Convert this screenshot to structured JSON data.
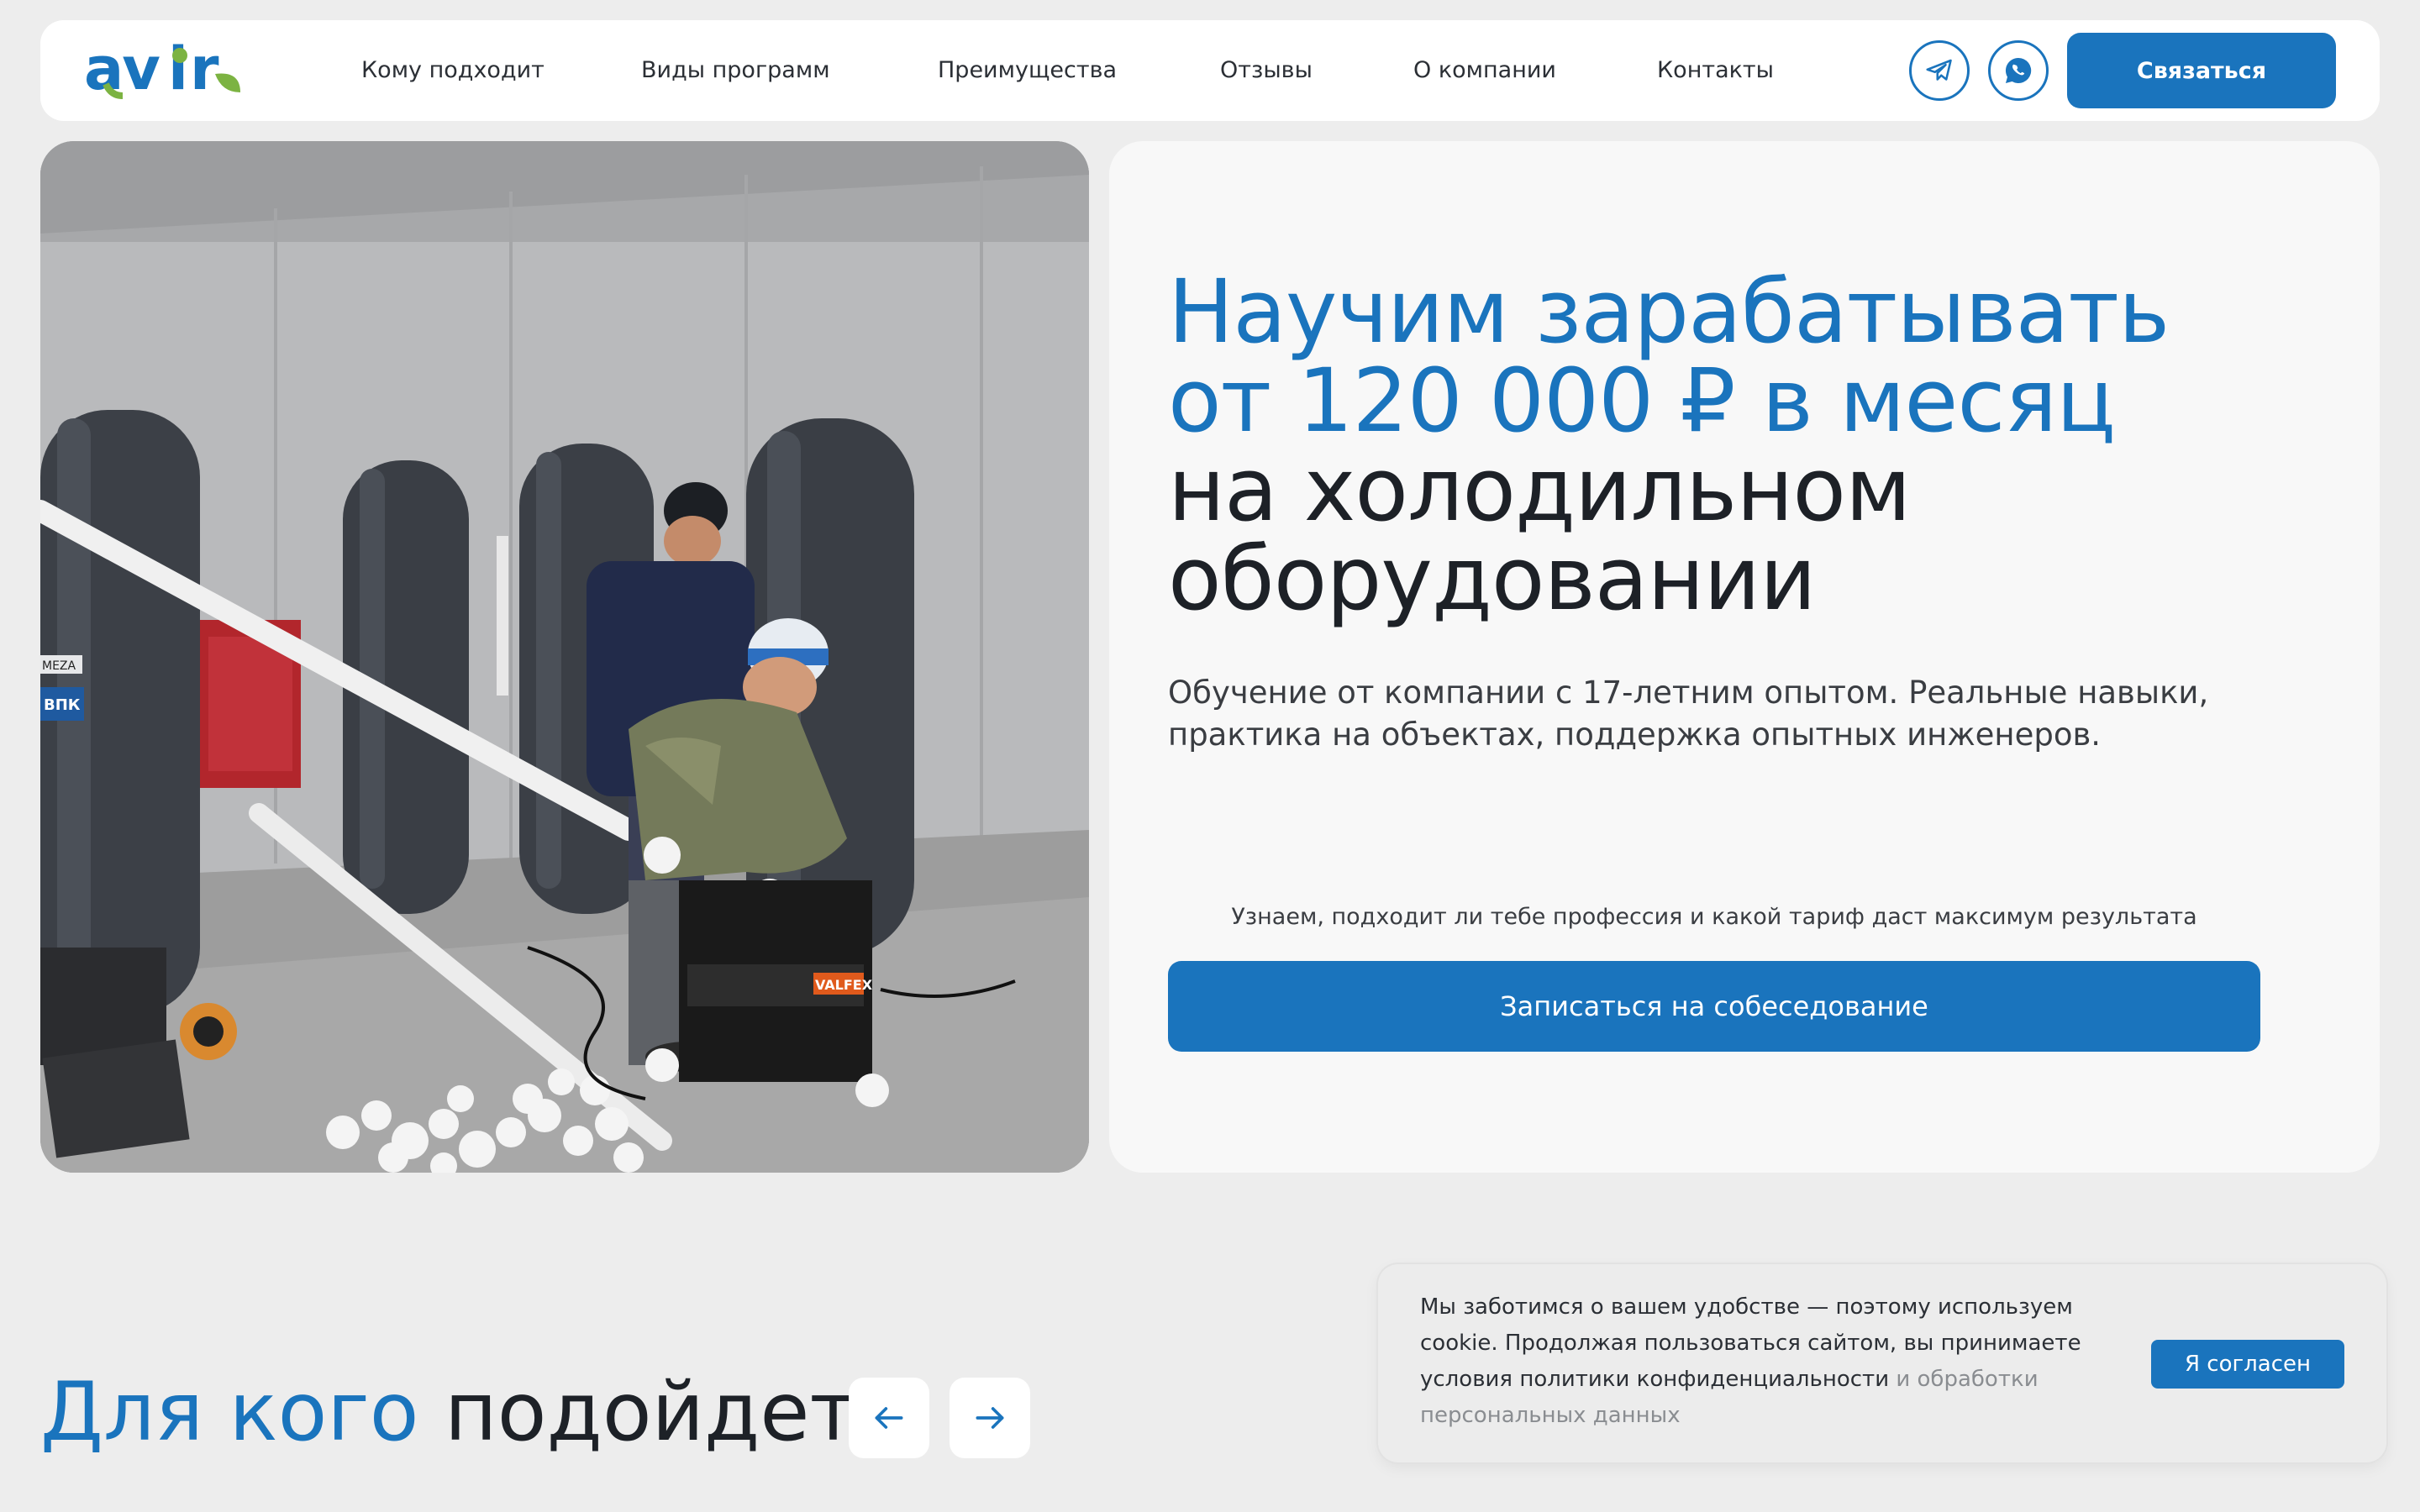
{
  "header": {
    "logo_text": "avir",
    "nav": [
      {
        "label": "Кому подходит"
      },
      {
        "label": "Виды программ"
      },
      {
        "label": "Преимущества"
      },
      {
        "label": "Отзывы"
      },
      {
        "label": "О компании"
      },
      {
        "label": "Контакты"
      }
    ],
    "telegram_icon": "telegram-icon",
    "whatsapp_icon": "whatsapp-icon",
    "contact_label": "Связаться"
  },
  "hero": {
    "title_line1": "Научим зарабатывать",
    "title_line2": "от 120 000 ₽ в месяц",
    "title_line3": "на холодильном",
    "title_line4": "оборудовании",
    "subtitle": "Обучение от компании с 17-летним опытом. Реальные навыки, практика на объектах, поддержка опытных инженеров.",
    "hint": "Узнаем, подходит ли тебе профессия и какой тариф даст максимум результата",
    "cta_label": "Записаться на собеседование",
    "photo_labels": {
      "meza": "MEZA",
      "vpk": "ВПК",
      "valfex": "VALFEX"
    }
  },
  "section": {
    "title_blue": "Для кого",
    "title_dark": "подойдет"
  },
  "cookie": {
    "text_main": "Мы заботимся о вашем удобстве — поэтому используем cookie. Продолжая пользоваться сайтом, вы принимаете условия политики конфиденциальности",
    "text_muted": " и обработки персональных данных",
    "accept_label": "Я согласен"
  },
  "colors": {
    "accent": "#1a74bd",
    "logo_green": "#7cb342",
    "background": "#ededed"
  }
}
